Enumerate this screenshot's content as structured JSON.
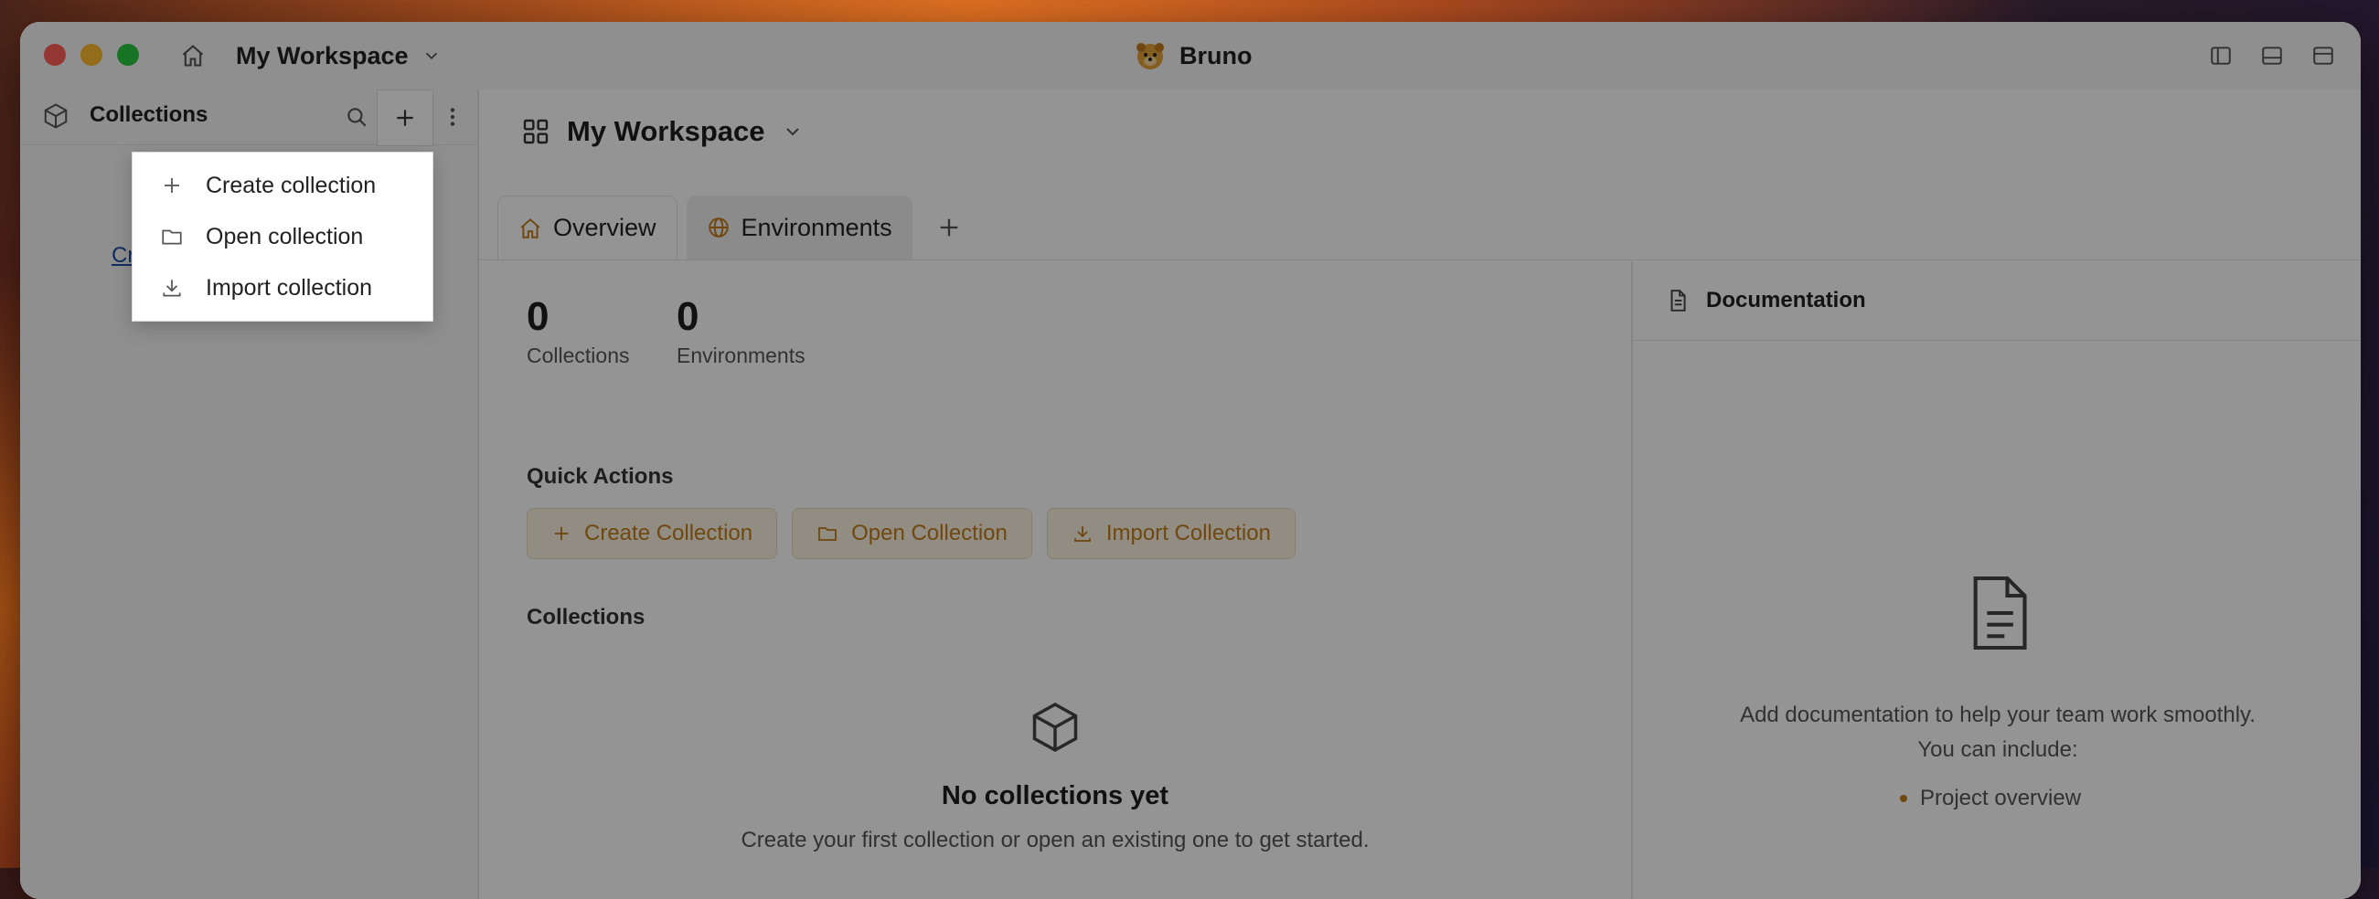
{
  "titlebar": {
    "workspace": "My Workspace",
    "app_name": "Bruno"
  },
  "sidebar": {
    "title": "Collections",
    "create_link": "Cr",
    "dropdown": [
      {
        "label": "Create collection",
        "icon": "plus-icon"
      },
      {
        "label": "Open collection",
        "icon": "folder-icon"
      },
      {
        "label": "Import collection",
        "icon": "download-icon"
      }
    ]
  },
  "main": {
    "workspace_title": "My Workspace",
    "tabs": [
      {
        "label": "Overview",
        "icon": "home-icon",
        "active": true
      },
      {
        "label": "Environments",
        "icon": "globe-icon",
        "active": false
      }
    ],
    "stats": [
      {
        "value": "0",
        "label": "Collections"
      },
      {
        "value": "0",
        "label": "Environments"
      }
    ],
    "quick_actions_label": "Quick Actions",
    "quick_actions": [
      {
        "label": "Create Collection",
        "icon": "plus-icon"
      },
      {
        "label": "Open Collection",
        "icon": "folder-icon"
      },
      {
        "label": "Import Collection",
        "icon": "download-icon"
      }
    ],
    "collections_label": "Collections",
    "empty_title": "No collections yet",
    "empty_subtitle": "Create your first collection or open an existing one to get started."
  },
  "documentation": {
    "title": "Documentation",
    "line1": "Add documentation to help your team work smoothly.",
    "line2": "You can include:",
    "bullet1": "Project overview"
  },
  "colors": {
    "accent": "#c07a1a",
    "link": "#1d4fa8"
  }
}
